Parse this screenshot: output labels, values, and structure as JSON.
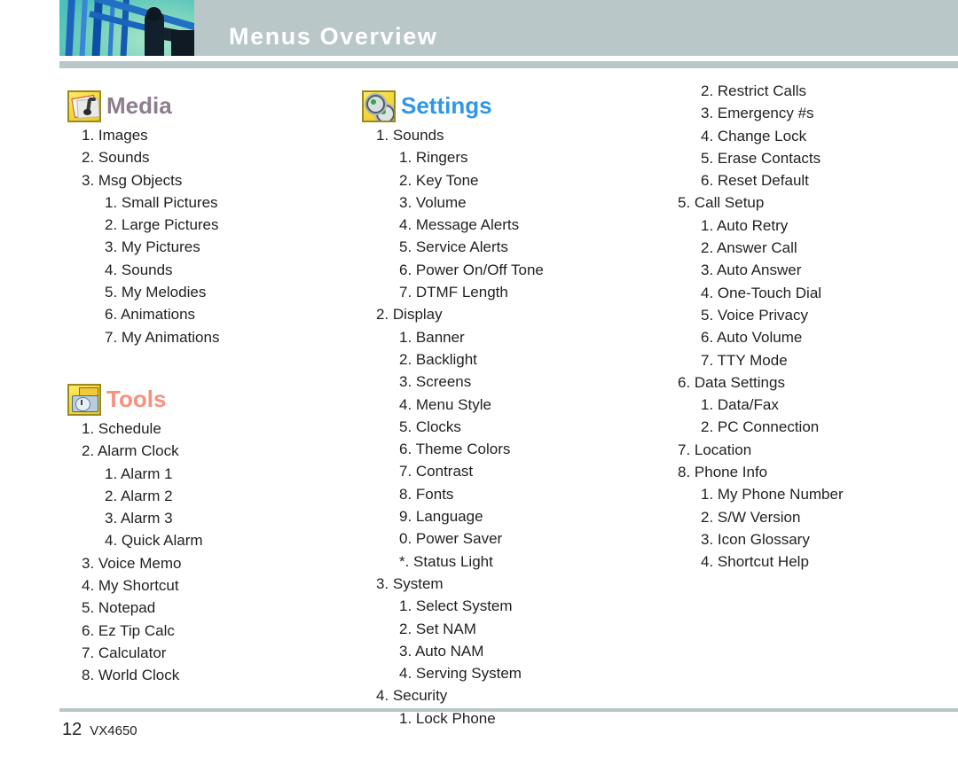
{
  "header": {
    "title": "Menus Overview",
    "photo_alt": "abstract-blue-teal-photo"
  },
  "footer": {
    "page_number": "12",
    "model": "VX4650"
  },
  "colors": {
    "header_bar": "#b9c7c9",
    "header_title": "#ffffff",
    "media_title": "#8d7d8f",
    "tools_title": "#fb8f7d",
    "settings_title": "#2f96e8",
    "body_text": "#231f20",
    "icon_tile": "#f5d93a"
  },
  "columns": [
    {
      "id": "column-left",
      "sections": [
        {
          "title": "Media",
          "icon": "media-folder-icon",
          "color_key": "media_title",
          "lines": [
            {
              "level": 1,
              "text": "1. Images"
            },
            {
              "level": 1,
              "text": "2. Sounds"
            },
            {
              "level": 1,
              "text": "3. Msg Objects"
            },
            {
              "level": 2,
              "text": "1. Small Pictures"
            },
            {
              "level": 2,
              "text": "2. Large Pictures"
            },
            {
              "level": 2,
              "text": "3. My Pictures"
            },
            {
              "level": 2,
              "text": "4. Sounds"
            },
            {
              "level": 2,
              "text": "5. My Melodies"
            },
            {
              "level": 2,
              "text": "6. Animations"
            },
            {
              "level": 2,
              "text": "7. My Animations"
            }
          ]
        },
        {
          "title": "Tools",
          "icon": "toolbox-icon",
          "color_key": "tools_title",
          "lines": [
            {
              "level": 1,
              "text": "1. Schedule"
            },
            {
              "level": 1,
              "text": "2. Alarm Clock"
            },
            {
              "level": 2,
              "text": "1. Alarm 1"
            },
            {
              "level": 2,
              "text": "2. Alarm 2"
            },
            {
              "level": 2,
              "text": "3. Alarm 3"
            },
            {
              "level": 2,
              "text": "4. Quick Alarm"
            },
            {
              "level": 1,
              "text": "3. Voice Memo"
            },
            {
              "level": 1,
              "text": "4. My Shortcut"
            },
            {
              "level": 1,
              "text": "5. Notepad"
            },
            {
              "level": 1,
              "text": "6. Ez Tip Calc"
            },
            {
              "level": 1,
              "text": "7. Calculator"
            },
            {
              "level": 1,
              "text": "8. World Clock"
            }
          ]
        }
      ]
    },
    {
      "id": "column-middle",
      "sections": [
        {
          "title": "Settings",
          "icon": "gears-icon",
          "color_key": "settings_title",
          "lines": [
            {
              "level": 1,
              "text": "1. Sounds"
            },
            {
              "level": 2,
              "text": "1. Ringers"
            },
            {
              "level": 2,
              "text": "2. Key Tone"
            },
            {
              "level": 2,
              "text": "3. Volume"
            },
            {
              "level": 2,
              "text": "4. Message Alerts"
            },
            {
              "level": 2,
              "text": "5. Service Alerts"
            },
            {
              "level": 2,
              "text": "6. Power On/Off Tone"
            },
            {
              "level": 2,
              "text": "7. DTMF Length"
            },
            {
              "level": 1,
              "text": "2. Display"
            },
            {
              "level": 2,
              "text": "1. Banner"
            },
            {
              "level": 2,
              "text": "2. Backlight"
            },
            {
              "level": 2,
              "text": "3. Screens"
            },
            {
              "level": 2,
              "text": "4. Menu Style"
            },
            {
              "level": 2,
              "text": "5. Clocks"
            },
            {
              "level": 2,
              "text": "6. Theme Colors"
            },
            {
              "level": 2,
              "text": "7. Contrast"
            },
            {
              "level": 2,
              "text": "8. Fonts"
            },
            {
              "level": 2,
              "text": "9. Language"
            },
            {
              "level": 2,
              "text": "0. Power Saver"
            },
            {
              "level": 2,
              "text": "*. Status Light"
            },
            {
              "level": 1,
              "text": "3. System"
            },
            {
              "level": 2,
              "text": "1. Select System"
            },
            {
              "level": 2,
              "text": "2. Set NAM"
            },
            {
              "level": 2,
              "text": "3. Auto NAM"
            },
            {
              "level": 2,
              "text": "4. Serving System"
            },
            {
              "level": 1,
              "text": "4. Security"
            },
            {
              "level": 2,
              "text": "1. Lock Phone"
            }
          ]
        }
      ]
    },
    {
      "id": "column-right",
      "sections": [
        {
          "title": "",
          "icon": "",
          "color_key": "",
          "lines": [
            {
              "level": 2,
              "text": "2. Restrict Calls"
            },
            {
              "level": 2,
              "text": "3. Emergency #s"
            },
            {
              "level": 2,
              "text": "4. Change Lock"
            },
            {
              "level": 2,
              "text": "5. Erase Contacts"
            },
            {
              "level": 2,
              "text": "6. Reset Default"
            },
            {
              "level": 1,
              "text": "5. Call Setup"
            },
            {
              "level": 2,
              "text": "1. Auto Retry"
            },
            {
              "level": 2,
              "text": "2. Answer Call"
            },
            {
              "level": 2,
              "text": "3. Auto Answer"
            },
            {
              "level": 2,
              "text": "4. One-Touch Dial"
            },
            {
              "level": 2,
              "text": "5. Voice Privacy"
            },
            {
              "level": 2,
              "text": "6. Auto Volume"
            },
            {
              "level": 2,
              "text": "7. TTY Mode"
            },
            {
              "level": 1,
              "text": "6. Data Settings"
            },
            {
              "level": 2,
              "text": "1. Data/Fax"
            },
            {
              "level": 2,
              "text": "2. PC Connection"
            },
            {
              "level": 1,
              "text": "7. Location"
            },
            {
              "level": 1,
              "text": "8. Phone Info"
            },
            {
              "level": 2,
              "text": "1. My Phone Number"
            },
            {
              "level": 2,
              "text": "2. S/W Version"
            },
            {
              "level": 2,
              "text": "3. Icon Glossary"
            },
            {
              "level": 2,
              "text": "4. Shortcut Help"
            }
          ]
        }
      ]
    }
  ]
}
